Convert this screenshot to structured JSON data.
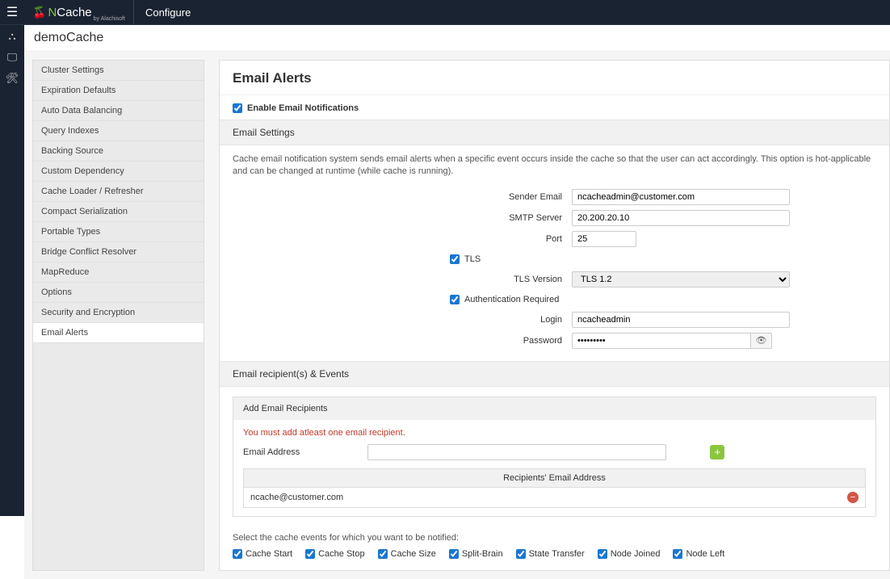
{
  "topbar": {
    "brand_pre": "N",
    "brand_rest": "Cache",
    "brand_sub": "by Alachisoft",
    "configure": "Configure"
  },
  "breadcrumb": "demoCache",
  "sidenav": [
    "Cluster Settings",
    "Expiration Defaults",
    "Auto Data Balancing",
    "Query Indexes",
    "Backing Source",
    "Custom Dependency",
    "Cache Loader / Refresher",
    "Compact Serialization",
    "Portable Types",
    "Bridge Conflict Resolver",
    "MapReduce",
    "Options",
    "Security and Encryption",
    "Email Alerts"
  ],
  "panel": {
    "title": "Email Alerts",
    "enable_label": "Enable Email Notifications",
    "email_settings_header": "Email Settings",
    "desc": "Cache email notification system sends email alerts when a specific event occurs inside the cache so that the user can act accordingly. This option is hot-applicable and can be changed at runtime (while cache is running).",
    "sender_label": "Sender Email",
    "sender_value": "ncacheadmin@customer.com",
    "smtp_label": "SMTP Server",
    "smtp_value": "20.200.20.10",
    "port_label": "Port",
    "port_value": "25",
    "tls_label": "TLS",
    "tls_version_label": "TLS Version",
    "tls_version_value": "TLS 1.2",
    "auth_label": "Authentication Required",
    "login_label": "Login",
    "login_value": "ncacheadmin",
    "password_label": "Password",
    "password_value": "•••••••••",
    "recipients_header": "Email recipient(s) & Events",
    "add_recipients_header": "Add Email Recipients",
    "warn": "You must add atleast one email recipient.",
    "email_address_label": "Email Address",
    "table_header": "Recipients' Email Address",
    "recipient_row": "ncache@customer.com",
    "events_desc": "Select the cache events for which you want to be notified:",
    "events": [
      "Cache Start",
      "Cache Stop",
      "Cache Size",
      "Split-Brain",
      "State Transfer",
      "Node Joined",
      "Node Left"
    ]
  }
}
